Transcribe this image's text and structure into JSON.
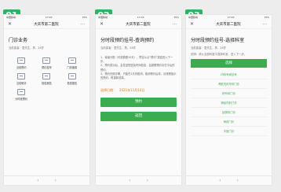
{
  "steps": [
    "01",
    "02",
    "03"
  ],
  "status_bar": {
    "carrier": "中国移动",
    "time": "17:03",
    "battery": "75%"
  },
  "nav": {
    "close": "✕",
    "title": "大庆市第二医院",
    "more": "···"
  },
  "screen1": {
    "title": "门诊业务",
    "patient": "当前患者：童先生，男，26岁",
    "menu": [
      {
        "label": "当前预约",
        "icon": "calendar-icon"
      },
      {
        "label": "预约挂号",
        "icon": "register-icon"
      },
      {
        "label": "门诊缴费",
        "icon": "payment-icon"
      },
      {
        "label": "当前候诊",
        "icon": "queue-icon"
      },
      {
        "label": "检验报告",
        "icon": "report-icon"
      },
      {
        "label": "检查报告",
        "icon": "exam-icon"
      },
      {
        "label": "分时段预约",
        "icon": "time-slot-icon"
      }
    ]
  },
  "screen2": {
    "title": "分时段预约挂号-查询预约",
    "patient": "当前患者：童先生，男，26岁",
    "desc": [
      "1、省级分配（可选数额15天），预定从点“预约”按钮进入下一步。",
      "2、预约成功后，会发送短信及时间信息，会超期预约请在今后的预约。",
      "3、预约在候诊期，只能在1天内取消，取消预约后将，请按照指示的预约，再重新选择。"
    ],
    "selected_label": "选择日期：",
    "selected_date": "2021年11月14日",
    "btn_book": "预约",
    "btn_back": "返回"
  },
  "screen3": {
    "title": "分时段预约挂号-选择科室",
    "patient": "当前患者：童先生，男，26岁",
    "note": "说明：请从全部科室中选择科室，进入下一步。",
    "btn_choose": "选择",
    "departments": [
      "内科专家挂号",
      "肾脏内科专科门诊",
      "肝外科门诊",
      "神经内科门诊",
      "结核科门诊",
      "骨科门诊",
      "中医门诊"
    ]
  },
  "bottom_bar": {
    "back": "‹",
    "forward": "›"
  }
}
